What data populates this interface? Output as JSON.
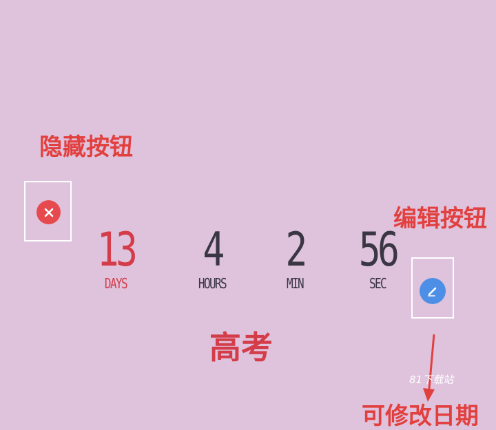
{
  "annotations": {
    "hide_button": "隐藏按钮",
    "edit_button": "编辑按钮",
    "modify_date": "可修改日期"
  },
  "countdown": {
    "days": {
      "value": "13",
      "label": "DAYS",
      "color": "#d43c49"
    },
    "hours": {
      "value": "4",
      "label": "HOURS",
      "color": "#3a3644"
    },
    "min": {
      "value": "2",
      "label": "MIN",
      "color": "#3a3644"
    },
    "sec": {
      "value": "56",
      "label": "SEC",
      "color": "#3a3644"
    }
  },
  "event": {
    "title": "高考"
  },
  "watermark": "81下载站",
  "icons": {
    "hide": "close-icon",
    "edit": "pencil-icon"
  },
  "colors": {
    "background": "#dfc3dc",
    "annotation": "#e2403f",
    "hide_button": "#e64a4e",
    "edit_button": "#4d8fe6"
  }
}
